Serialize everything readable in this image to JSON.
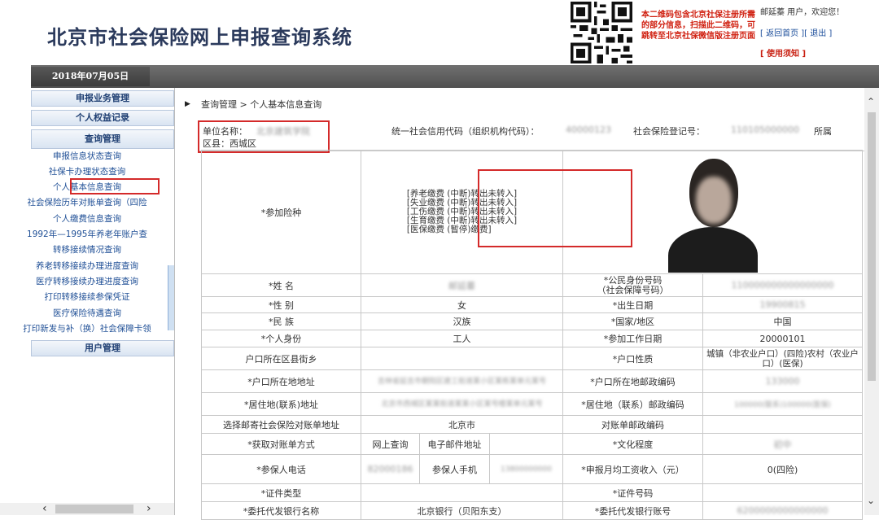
{
  "header": {
    "site_title": "北京市社会保险网上申报查询系统",
    "qr_note": "本二维码包含北京社保注册所需的部分信息，扫描此二维码，可跳转至北京社保微信版注册页面",
    "user_greeting": "邮延蓁 用户，欢迎您！",
    "back_home": "[ 返回首页 ]",
    "logout": "[ 退出 ]",
    "notice": "[ 使用须知 ]"
  },
  "topbar": {
    "date": "2018年07月05日"
  },
  "sidebar": {
    "head_declare": "申报业务管理",
    "head_rights": "个人权益记录",
    "head_query": "查询管理",
    "items": [
      "申报信息状态查询",
      "社保卡办理状态查询",
      "个人基本信息查询",
      "社会保险历年对账单查询（四险",
      "个人缴费信息查询",
      "1992年—1995年养老年账户查",
      "转移接续情况查询",
      "养老转移接续办理进度查询",
      "医疗转移接续办理进度查询",
      "打印转移接续参保凭证",
      "医疗保险待遇查询",
      "打印新发与补（换）社会保障卡领"
    ],
    "head_user": "用户管理"
  },
  "main": {
    "breadcrumb": "查询管理 > 个人基本信息查询",
    "unit_name_label": "单位名称：",
    "unit_name_value": "北京建筑学院",
    "district_label": "区县：西城区",
    "credit_label": "统一社会信用代码（组织机构代码）：",
    "credit_value": "40000123",
    "ss_label": "社会保险登记号：",
    "ss_value": "110105000000",
    "belong_label": "所属"
  },
  "table": {
    "insurance_label": "*参加险种",
    "insurance_items": [
      "[养老缴费 (中断)转出未转入]",
      "[失业缴费 (中断)转出未转入]",
      "[工伤缴费 (中断)转出未转入]",
      "[生育缴费 (中断)转出未转入]",
      "[医保缴费 (暂停)缴费]"
    ],
    "name_label": "*姓 名",
    "name_value": "邮延蓁",
    "id_label": "*公民身份号码\n（社会保障号码）",
    "id_value": "110000000000000000",
    "gender_label": "*性 别",
    "gender_value": "女",
    "birth_label": "*出生日期",
    "birth_value": "19900815",
    "ethnic_label": "*民 族",
    "ethnic_value": "汉族",
    "country_label": "*国家/地区",
    "country_value": "中国",
    "identity_label": "*个人身份",
    "identity_value": "工人",
    "work_date_label": "*参加工作日期",
    "work_date_value": "20000101",
    "hukou_street_label": "户口所在区县街乡",
    "hukou_street_value": "",
    "hukou_type_label": "*户口性质",
    "hukou_type_value": "城镇（非农业户口）(四险)农村（农业户口）(医保)",
    "hukou_addr_label": "*户口所在地地址",
    "hukou_addr_value": "吉林省延吉市朝阳区建工街道某小区某栋某单元某号",
    "hukou_zip_label": "*户口所在地邮政编码",
    "hukou_zip_value": "133000",
    "live_addr_label": "*居住地(联系)地址",
    "live_addr_value": "北京市西城区某某街道某某小区某号楼某单元某号",
    "live_zip_label": "*居住地（联系）邮政编码",
    "live_zip_value": "100000(联系)100000(医保)",
    "mail_addr_label": "选择邮寄社会保险对账单地址",
    "mail_addr_value": "北京市",
    "statement_zip_label": "对账单邮政编码",
    "statement_zip_value": "",
    "method_label": "*获取对账单方式",
    "method_value": "网上查询",
    "email_label": "电子邮件地址",
    "email_value": "",
    "education_label": "*文化程度",
    "education_value": "初中",
    "phone_label": "*参保人电话",
    "phone_value": "82000186",
    "mobile_label": "参保人手机",
    "mobile_value": "13800000000",
    "income_label": "*申报月均工资收入（元）",
    "income_value": "0(四险)",
    "cert_type_label": "*证件类型",
    "cert_type_value": "",
    "cert_no_label": "*证件号码",
    "cert_no_value": "",
    "bank_label": "*委托代发银行名称",
    "bank_value": "北京银行（贝阳东支）",
    "bank_acc_label": "*委托代发银行账号",
    "bank_acc_value": "6200000000000000"
  }
}
